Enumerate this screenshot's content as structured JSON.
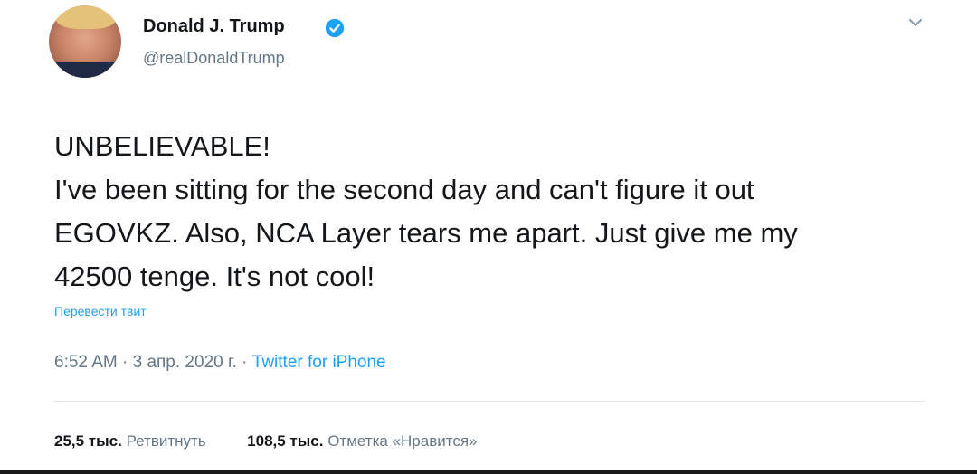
{
  "author": {
    "display_name": "Donald J. Trump",
    "handle": "@realDonaldTrump",
    "verified": true
  },
  "menu_icon": "chevron-down-icon",
  "tweet": {
    "lines": [
      "UNBELIEVABLE!",
      "I've been sitting for the second day and can't figure it out",
      "EGOVKZ. Also, NCA Layer tears me apart. Just give me my",
      "42500 tenge. It's not cool!"
    ],
    "translate_label": "Перевести твит"
  },
  "meta": {
    "time": "6:52 AM",
    "separator": "·",
    "date": "3 апр. 2020 г.",
    "source": "Twitter for iPhone"
  },
  "stats": {
    "retweets_count": "25,5 тыс.",
    "retweets_label": "Ретвитнуть",
    "likes_count": "108,5 тыс.",
    "likes_label": "Отметка «Нравится»"
  },
  "colors": {
    "link": "#1da1f2",
    "secondary_text": "#657786",
    "primary_text": "#14171a",
    "divider": "#e1e8ed"
  }
}
